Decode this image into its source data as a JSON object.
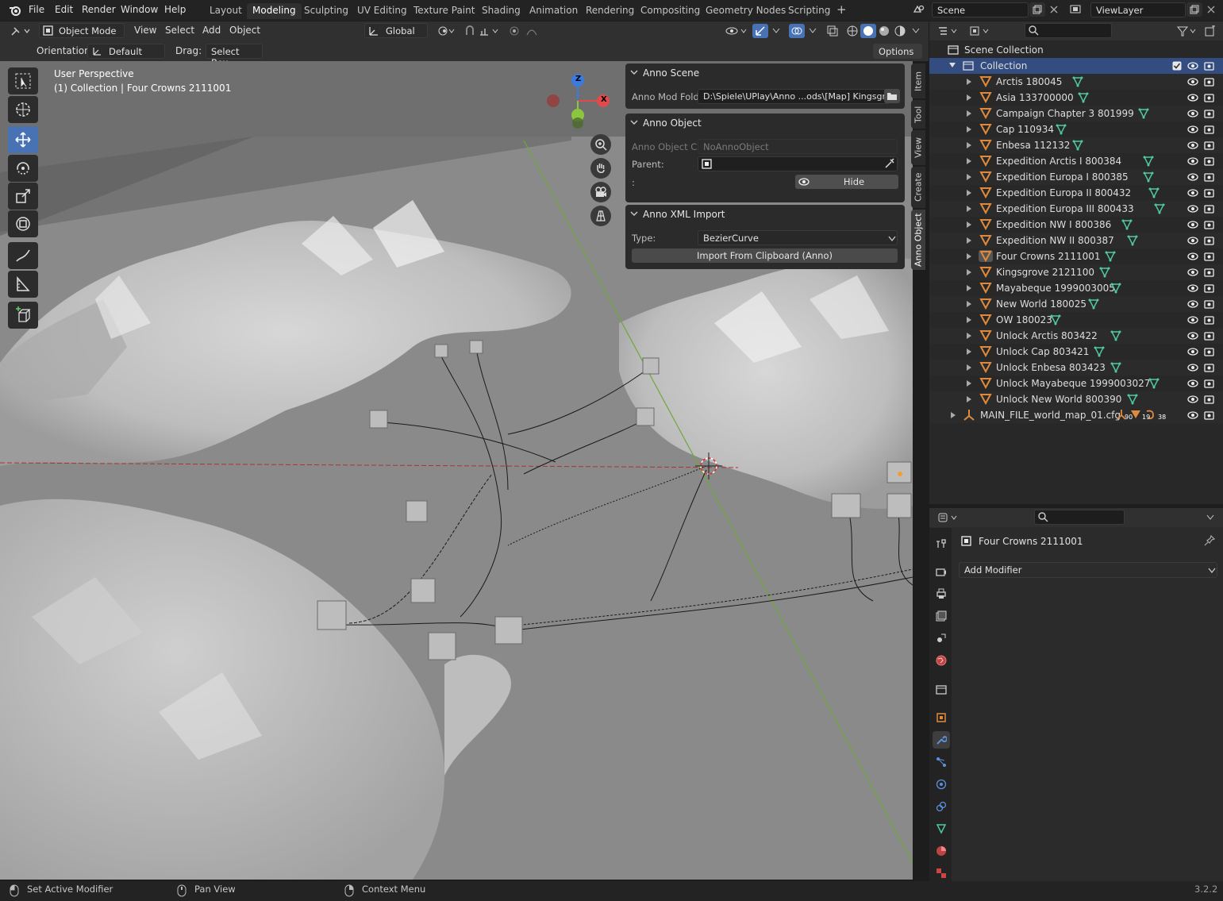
{
  "topbar": {
    "menus": [
      "File",
      "Edit",
      "Render",
      "Window",
      "Help"
    ],
    "workspaces": [
      "Layout",
      "Modeling",
      "Sculpting",
      "UV Editing",
      "Texture Paint",
      "Shading",
      "Animation",
      "Rendering",
      "Compositing",
      "Geometry Nodes",
      "Scripting"
    ],
    "active_workspace": "Modeling",
    "add_tab": "+",
    "scene": "Scene",
    "view_layer": "ViewLayer"
  },
  "viewport_header": {
    "mode": "Object Mode",
    "menus": [
      "View",
      "Select",
      "Add",
      "Object"
    ],
    "transform_orientation": "Global"
  },
  "tool_settings": {
    "orientation_label": "Orientation:",
    "orientation_value": "Default",
    "drag_label": "Drag:",
    "drag_value": "Select Box",
    "options": "Options"
  },
  "viewport": {
    "perspective": "User Perspective",
    "info": "(1) Collection | Four Crowns 2111001",
    "gizmo": {
      "z": "Z",
      "x": "X"
    }
  },
  "npanel": {
    "scene": {
      "title": "Anno Scene",
      "mod_folder_label": "Anno Mod Fold...",
      "mod_folder_value": "D:\\Spiele\\UPlay\\Anno ...ods\\[Map] Kingsgrove\\"
    },
    "object": {
      "title": "Anno Object",
      "class_label": "Anno Object Cl...",
      "class_value": "NoAnnoObject",
      "parent_label": "Parent:",
      "colon_label": ":",
      "hide_button": "Hide"
    },
    "xml_import": {
      "title": "Anno XML Import",
      "type_label": "Type:",
      "type_value": "BezierCurve",
      "import_button": "Import From Clipboard (Anno)"
    },
    "tabs": [
      "Item",
      "Tool",
      "View",
      "Create",
      "Anno Object"
    ],
    "active_tab": "Anno Object"
  },
  "outliner": {
    "root": "Scene Collection",
    "collection": "Collection",
    "items": [
      "Arctis 180045",
      "Asia 133700000",
      "Campaign Chapter 3 801999",
      "Cap 110934",
      "Enbesa 112132",
      "Expedition Arctis I 800384",
      "Expedition Europa I 800385",
      "Expedition Europa II 800432",
      "Expedition Europa III 800433",
      "Expedition NW I 800386",
      "Expedition NW II 800387",
      "Four Crowns 2111001",
      "Kingsgrove 2121100",
      "Mayabeque 1999003005",
      "New World 180025",
      "OW 180023",
      "Unlock Arctis 803422",
      "Unlock Cap 803421",
      "Unlock Enbesa 803423",
      "Unlock Mayabeque 1999003027",
      "Unlock New World 800390"
    ],
    "active_item": "Four Crowns 2111001",
    "extra_item": "MAIN_FILE_world_map_01.cfg",
    "extra_badges": [
      "90",
      "19",
      "38"
    ]
  },
  "properties": {
    "object_name": "Four Crowns 2111001",
    "add_modifier": "Add Modifier"
  },
  "statusbar": {
    "left": "Set Active Modifier",
    "middle": "Pan View",
    "right": "Context Menu",
    "version": "3.2.2"
  },
  "colors": {
    "accent": "#4772b3",
    "mesh_icon": "#e08a3c",
    "data_icon": "#4fc9a0",
    "x_axis": "#e04a4a",
    "y_axis": "#8cc63f",
    "z_axis": "#3b7ae0"
  }
}
